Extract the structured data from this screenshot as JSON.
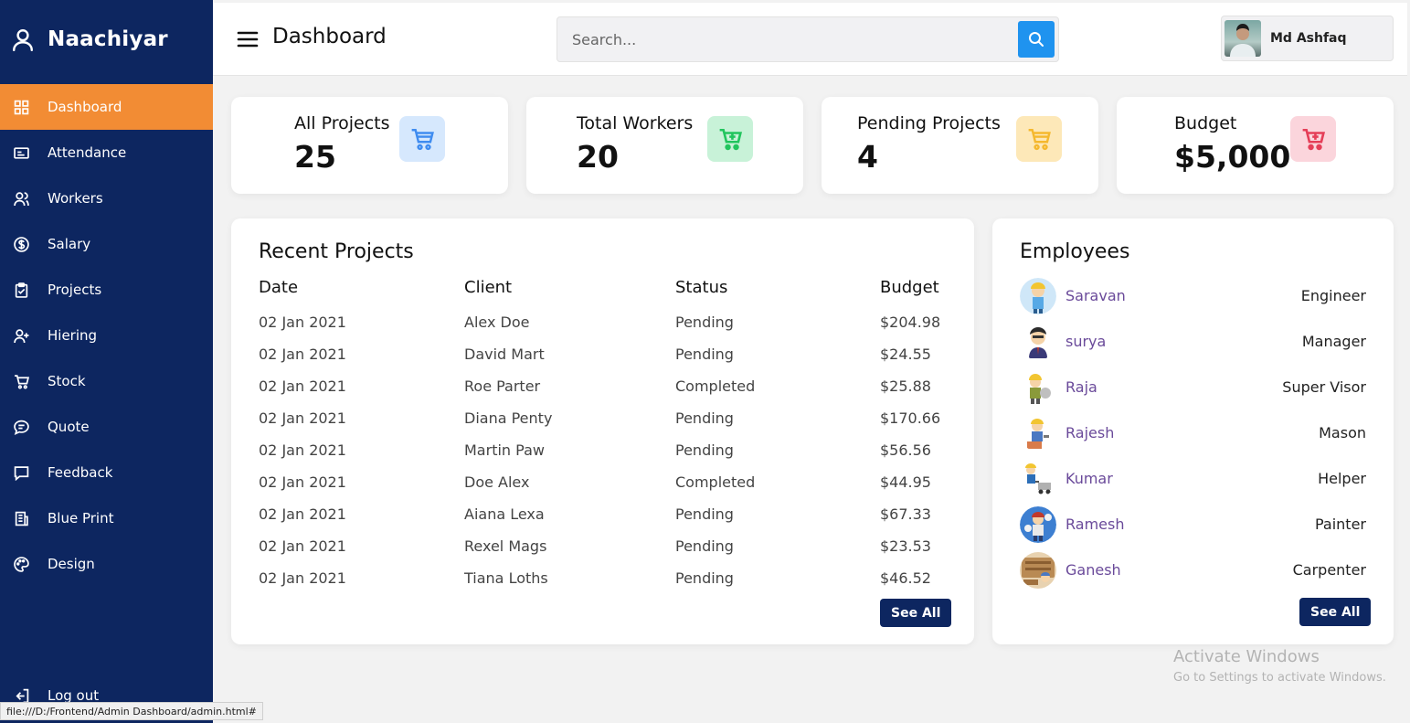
{
  "sidebar": {
    "brand": "Naachiyar",
    "items": [
      {
        "label": "Dashboard",
        "icon": "grid-icon"
      },
      {
        "label": "Attendance",
        "icon": "id-card-icon"
      },
      {
        "label": "Workers",
        "icon": "users-icon"
      },
      {
        "label": "Salary",
        "icon": "dollar-circle-icon"
      },
      {
        "label": "Projects",
        "icon": "clipboard-icon"
      },
      {
        "label": "Hiering",
        "icon": "user-plus-icon"
      },
      {
        "label": "Stock",
        "icon": "cart-icon"
      },
      {
        "label": "Quote",
        "icon": "chat-icon"
      },
      {
        "label": "Feedback",
        "icon": "message-icon"
      },
      {
        "label": "Blue Print",
        "icon": "building-icon"
      },
      {
        "label": "Design",
        "icon": "palette-icon"
      }
    ],
    "logout": "Log out",
    "active_color": "#f28c34",
    "bg_color": "#0d2660"
  },
  "topbar": {
    "title": "Dashboard",
    "search_placeholder": "Search...",
    "user_name": "Md Ashfaq"
  },
  "cards": [
    {
      "label": "All Projects",
      "value": "25",
      "icon": "cart-icon",
      "color": "#3f8cf0"
    },
    {
      "label": "Total Workers",
      "value": "20",
      "icon": "cart-plus-icon",
      "color": "#22c55e"
    },
    {
      "label": "Pending Projects",
      "value": "4",
      "icon": "cart-icon",
      "color": "#f5b82e"
    },
    {
      "label": "Budget",
      "value": "$5,000",
      "icon": "cart-plus-icon",
      "color": "#e53e58"
    }
  ],
  "recent": {
    "title": "Recent Projects",
    "headers": [
      "Date",
      "Client",
      "Status",
      "Budget"
    ],
    "rows": [
      [
        "02 Jan 2021",
        "Alex Doe",
        "Pending",
        "$204.98"
      ],
      [
        "02 Jan 2021",
        "David Mart",
        "Pending",
        "$24.55"
      ],
      [
        "02 Jan 2021",
        "Roe Parter",
        "Completed",
        "$25.88"
      ],
      [
        "02 Jan 2021",
        "Diana Penty",
        "Pending",
        "$170.66"
      ],
      [
        "02 Jan 2021",
        "Martin Paw",
        "Pending",
        "$56.56"
      ],
      [
        "02 Jan 2021",
        "Doe Alex",
        "Completed",
        "$44.95"
      ],
      [
        "02 Jan 2021",
        "Aiana Lexa",
        "Pending",
        "$67.33"
      ],
      [
        "02 Jan 2021",
        "Rexel Mags",
        "Pending",
        "$23.53"
      ],
      [
        "02 Jan 2021",
        "Tiana Loths",
        "Pending",
        "$46.52"
      ]
    ],
    "see_all": "See All"
  },
  "employees": {
    "title": "Employees",
    "items": [
      {
        "name": "Saravan",
        "role": "Engineer"
      },
      {
        "name": "surya",
        "role": "Manager"
      },
      {
        "name": "Raja",
        "role": "Super Visor"
      },
      {
        "name": "Rajesh",
        "role": "Mason"
      },
      {
        "name": "Kumar",
        "role": "Helper"
      },
      {
        "name": "Ramesh",
        "role": "Painter"
      },
      {
        "name": "Ganesh",
        "role": "Carpenter"
      }
    ],
    "see_all": "See All"
  },
  "watermark": {
    "line1": "Activate Windows",
    "line2": "Go to Settings to activate Windows."
  },
  "statusbar": "file:///D:/Frontend/Admin Dashboard/admin.html#"
}
